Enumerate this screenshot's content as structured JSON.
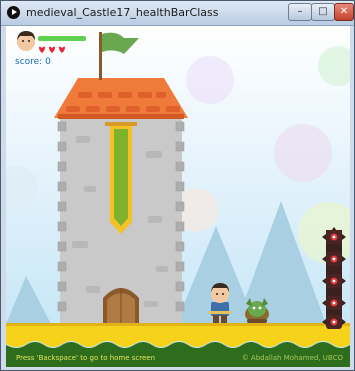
{
  "window": {
    "title": "medieval_Castle17_healthBarClass",
    "minimize_glyph": "–",
    "maximize_glyph": "□",
    "close_glyph": "✕"
  },
  "hud": {
    "score_text": "score: 0",
    "lives": 3,
    "health_fraction": 1.0
  },
  "footer": {
    "hint_text": "Press 'Backspace' to go to home screen",
    "credit_text": "© Abdallah Mohamed, UBCO"
  },
  "colors": {
    "sky_top": "#ffffff",
    "sky_bottom": "#bfe4f6",
    "roof": "#f07a3a",
    "banner": "#7fb22c",
    "flag": "#6aa84f",
    "health": "#5fd14f",
    "grass": "#f6d21a",
    "ground": "#2d6d1c"
  }
}
